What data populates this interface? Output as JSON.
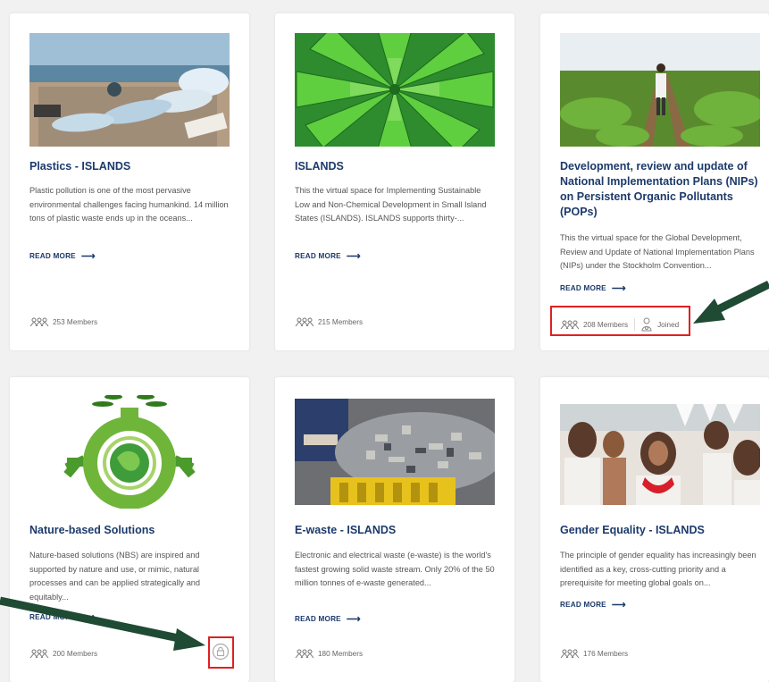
{
  "cards": [
    {
      "title": "Plastics - ISLANDS",
      "description": "Plastic pollution is one of the most pervasive environmental challenges facing humankind. 14 million tons of plastic waste ends up in the oceans...",
      "read_more": "READ MORE",
      "members": "253 Members",
      "image": "plastic-bottles-beach"
    },
    {
      "title": "ISLANDS",
      "description": "This the virtual space for Implementing Sustainable Low and Non-Chemical Development in Small Island States (ISLANDS). ISLANDS supports thirty-...",
      "read_more": "READ MORE",
      "members": "215 Members",
      "image": "green-leaf-spiral"
    },
    {
      "title": "Development, review and update of National Implementation Plans (NIPs) on Persistent Organic Pollutants (POPs)",
      "description": "This the virtual space for the Global Development, Review and Update of National Implementation Plans (NIPs) under the Stockholm Convention...",
      "read_more": "READ MORE",
      "members": "208 Members",
      "joined": "Joined",
      "image": "farmer-spraying-field"
    },
    {
      "title": "Nature-based Solutions",
      "description": "Nature-based solutions (NBS) are inspired and supported by nature and use, or mimic, natural processes and can be applied strategically and equitably...",
      "read_more": "READ MORE",
      "members": "200 Members",
      "image": "green-globe-lightbulb"
    },
    {
      "title": "E-waste - ISLANDS",
      "description": "Electronic and electrical waste (e-waste) is the world's fastest growing solid waste stream. Only 20% of the 50 million tonnes of e-waste generated...",
      "read_more": "READ MORE",
      "members": "180 Members",
      "image": "e-waste-pile"
    },
    {
      "title": "Gender Equality - ISLANDS",
      "description": "The principle of gender equality has increasingly been identified as a key, cross-cutting priority and a prerequisite for meeting global goals on...",
      "read_more": "READ MORE",
      "members": "176 Members",
      "image": "island-dancers"
    }
  ],
  "colors": {
    "title": "#1c3a6b",
    "highlight": "#e02020",
    "annotation_arrow": "#1f4a33"
  }
}
